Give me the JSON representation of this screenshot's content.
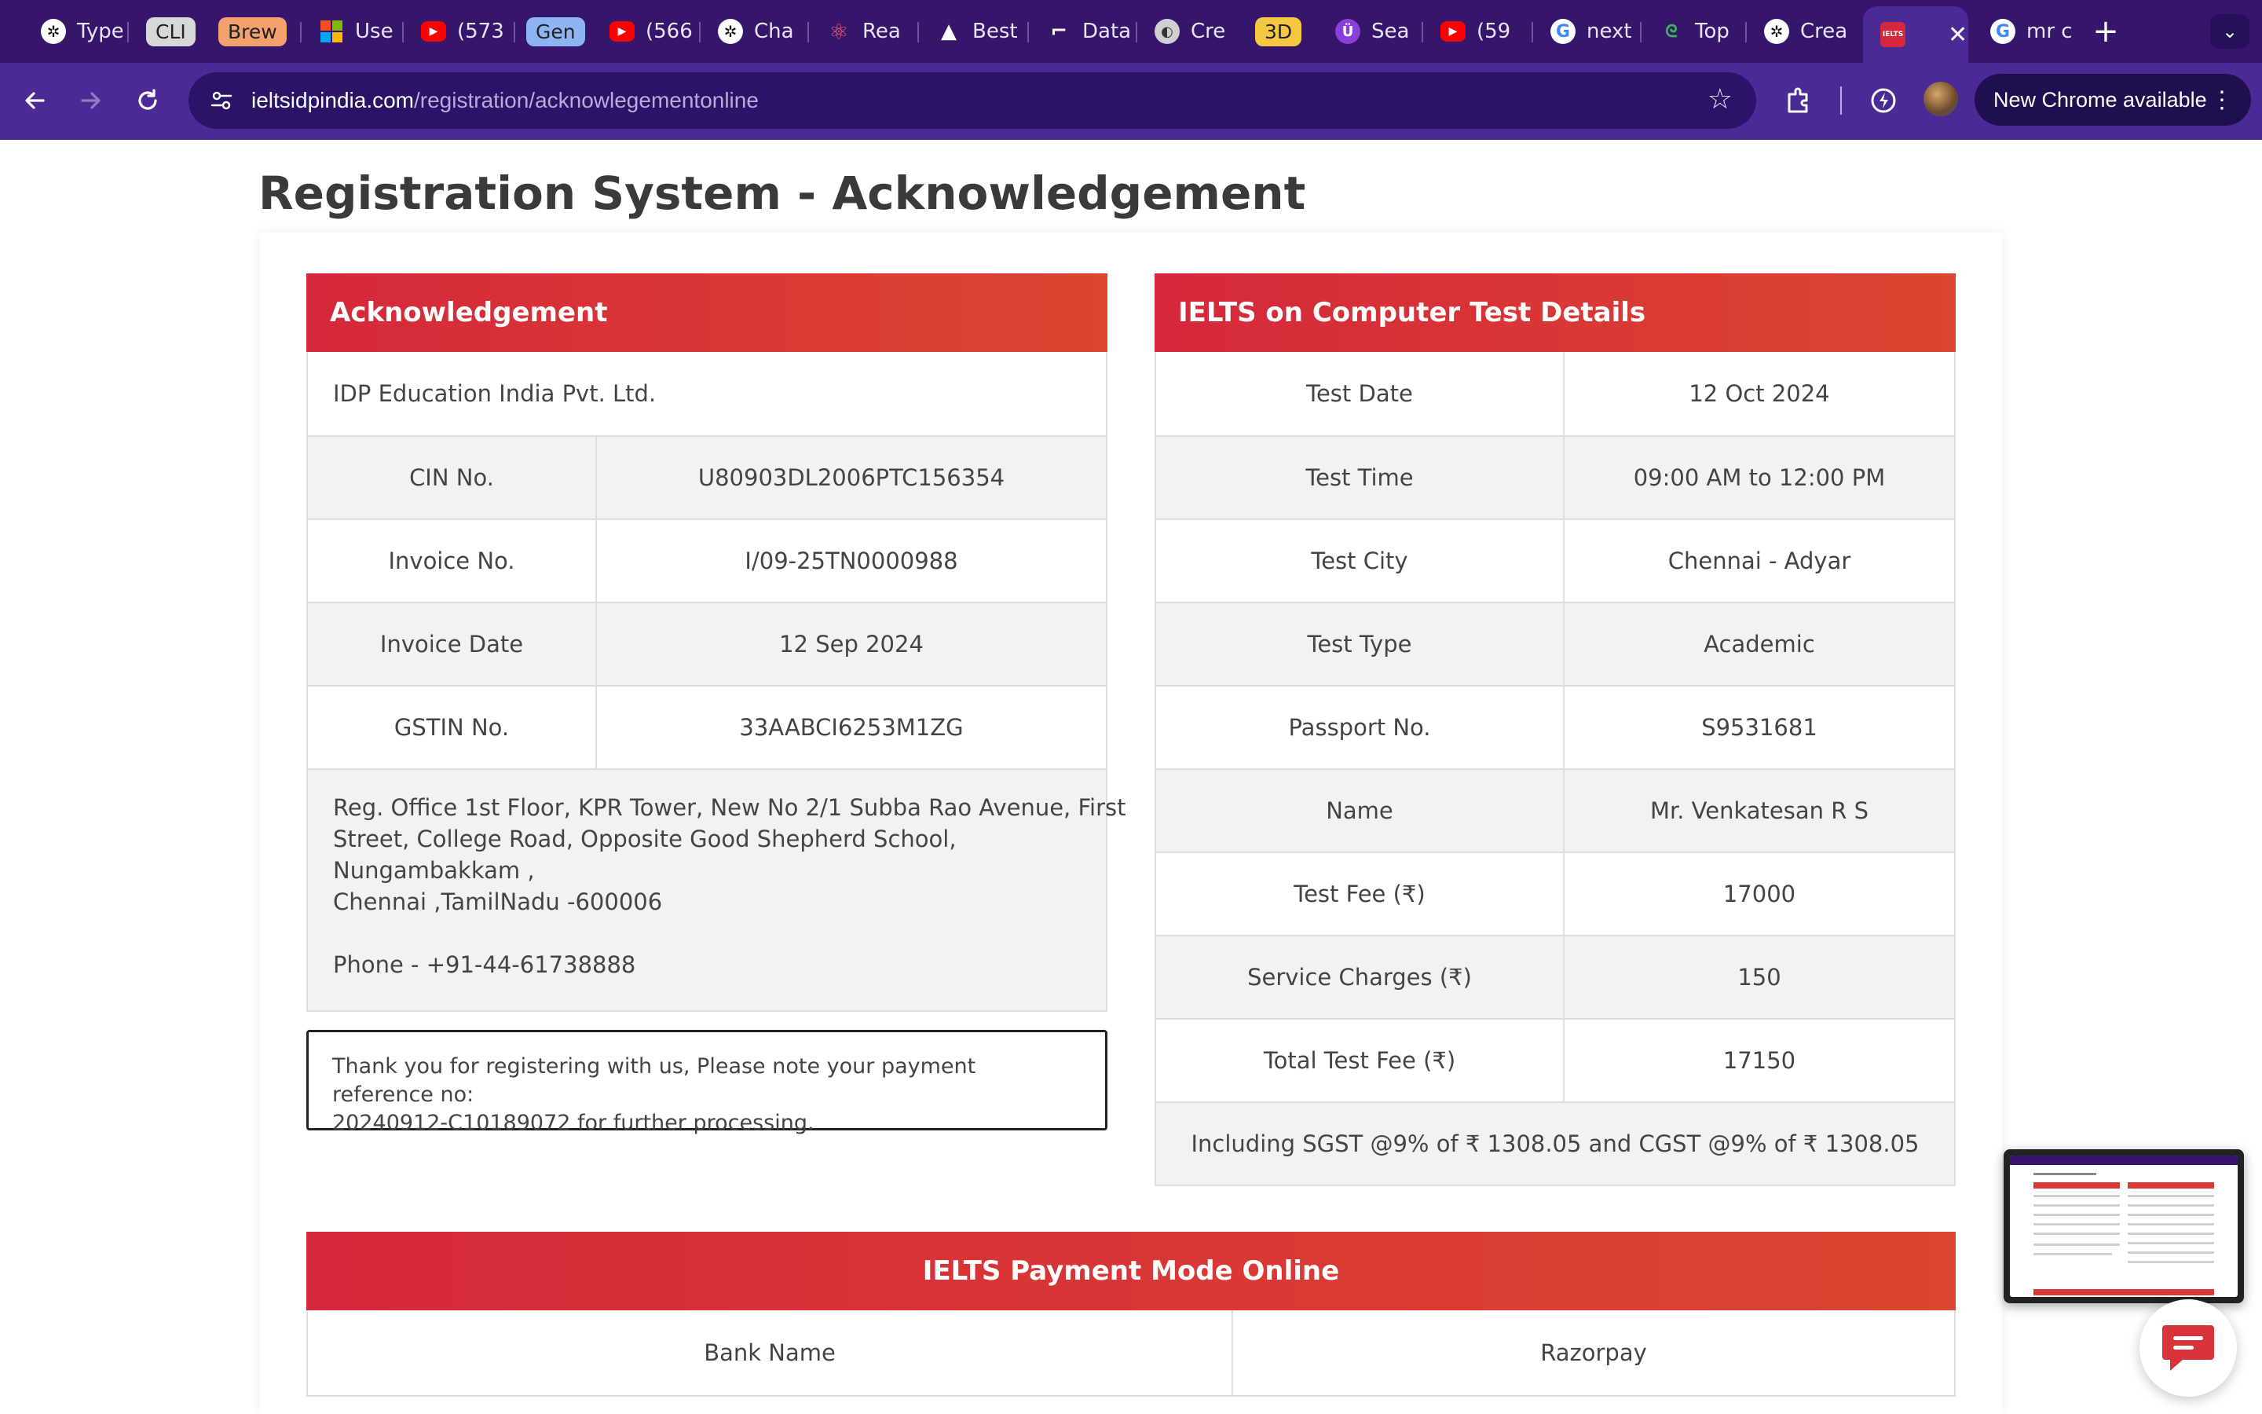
{
  "browser": {
    "tabs": [
      {
        "title": "Type",
        "icon": "openai-icon"
      },
      {
        "title": "CLI",
        "icon": "pill"
      },
      {
        "title": "Brew",
        "icon": "pill"
      },
      {
        "title": "Use",
        "icon": "microsoft-icon"
      },
      {
        "title": "(573",
        "icon": "youtube-icon"
      },
      {
        "title": "Gen",
        "icon": "pill"
      },
      {
        "title": "(566",
        "icon": "youtube-icon"
      },
      {
        "title": "Cha",
        "icon": "openai-icon"
      },
      {
        "title": "Rea",
        "icon": "react-icon"
      },
      {
        "title": "Best",
        "icon": "prism-icon"
      },
      {
        "title": "Data",
        "icon": "framer-icon"
      },
      {
        "title": "Cre",
        "icon": "globe-icon"
      },
      {
        "title": "3D",
        "icon": "pill"
      },
      {
        "title": "Sea",
        "icon": "search-icon"
      },
      {
        "title": "(59",
        "icon": "youtube-icon"
      },
      {
        "title": "next",
        "icon": "google-icon"
      },
      {
        "title": "Top",
        "icon": "geeks-icon"
      },
      {
        "title": "Crea",
        "icon": "openai-icon"
      },
      {
        "title": "IELTS",
        "icon": "ielts-icon"
      },
      {
        "title": "mr c",
        "icon": "google-icon"
      }
    ],
    "url_domain": "ieltsidpindia.com",
    "url_path": "/registration/acknowlegementonline",
    "update_label": "New Chrome available"
  },
  "page": {
    "title": "Registration System - Acknowledgement"
  },
  "acknowledgement": {
    "heading": "Acknowledgement",
    "company": "IDP Education India Pvt. Ltd.",
    "rows": [
      {
        "label": "CIN No.",
        "value": "U80903DL2006PTC156354"
      },
      {
        "label": "Invoice No.",
        "value": "I/09-25TN0000988"
      },
      {
        "label": "Invoice Date",
        "value": "12 Sep 2024"
      },
      {
        "label": "GSTIN No.",
        "value": "33AABCI6253M1ZG"
      }
    ],
    "address_lines": [
      "Reg. Office 1st Floor, KPR Tower, New No 2/1 Subba Rao Avenue, First",
      "Street, College Road, Opposite Good Shepherd School,",
      "Nungambakkam ,",
      "Chennai ,TamilNadu -600006"
    ],
    "phone": "Phone - +91-44-61738888",
    "notice_line1": "Thank you for registering with us, Please note your payment reference no:",
    "notice_line2": "20240912-C10189072 for further processing."
  },
  "test_details": {
    "heading": "IELTS on Computer Test Details",
    "rows": [
      {
        "label": "Test Date",
        "value": "12 Oct 2024"
      },
      {
        "label": "Test Time",
        "value": "09:00 AM to 12:00 PM"
      },
      {
        "label": "Test City",
        "value": "Chennai - Adyar"
      },
      {
        "label": "Test Type",
        "value": "Academic"
      },
      {
        "label": "Passport No.",
        "value": "S9531681"
      },
      {
        "label": "Name",
        "value": "Mr. Venkatesan R S"
      },
      {
        "label": "Test Fee (₹)",
        "value": "17000"
      },
      {
        "label": "Service Charges (₹)",
        "value": "150"
      },
      {
        "label": "Total Test Fee (₹)",
        "value": "17150"
      }
    ],
    "tax_note": "Including SGST @9% of ₹ 1308.05 and CGST @9% of ₹ 1308.05"
  },
  "payment": {
    "heading": "IELTS Payment Mode Online",
    "bank_label": "Bank Name",
    "bank_value": "Razorpay"
  },
  "colors": {
    "chrome_dark": "#35166b",
    "chrome_toolbar": "#4b2a96",
    "header_red": "#d5283b",
    "header_orange": "#dc4530",
    "row_alt": "#f2f2f2"
  }
}
